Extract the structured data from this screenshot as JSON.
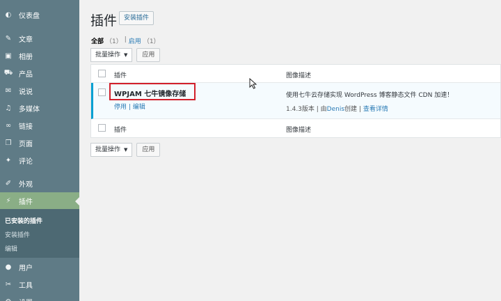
{
  "sidebar": {
    "items": [
      {
        "label": "仪表盘",
        "icon": "dashboard-icon",
        "glyph": "◐"
      },
      {
        "label": "文章",
        "icon": "pin-icon",
        "glyph": "✎"
      },
      {
        "label": "相册",
        "icon": "gallery-icon",
        "glyph": "▣"
      },
      {
        "label": "产品",
        "icon": "cart-icon",
        "glyph": "⛟"
      },
      {
        "label": "说说",
        "icon": "chat-icon",
        "glyph": "✉"
      },
      {
        "label": "多媒体",
        "icon": "media-icon",
        "glyph": "♫"
      },
      {
        "label": "链接",
        "icon": "link-icon",
        "glyph": "∞"
      },
      {
        "label": "页面",
        "icon": "page-icon",
        "glyph": "❐"
      },
      {
        "label": "评论",
        "icon": "comment-icon",
        "glyph": "✦"
      },
      {
        "label": "外观",
        "icon": "brush-icon",
        "glyph": "✐"
      },
      {
        "label": "插件",
        "icon": "plugin-icon",
        "glyph": "⚡"
      },
      {
        "label": "用户",
        "icon": "user-icon",
        "glyph": "●"
      },
      {
        "label": "工具",
        "icon": "wrench-icon",
        "glyph": "✂"
      },
      {
        "label": "设置",
        "icon": "settings-icon",
        "glyph": "⚙"
      }
    ],
    "submenu": [
      "已安装的插件",
      "安装插件",
      "编辑"
    ]
  },
  "header": {
    "title": "插件",
    "add_button": "安装插件"
  },
  "filters": {
    "all_label": "全部",
    "all_count": "（1）",
    "separator": "|",
    "active_label": "启用",
    "active_count": "（1）"
  },
  "bulk": {
    "select_label": "批量操作",
    "apply_label": "应用"
  },
  "table": {
    "col_name": "插件",
    "col_desc": "图像描述",
    "plugin": {
      "name": "WPJAM 七牛镜像存储",
      "actions": "停用 | 编辑",
      "description": "使用七牛云存储实现 WordPress 博客静态文件 CDN 加速！",
      "version": "1.4.3版本 | 由",
      "author": "Denis",
      "created": "创建 |",
      "details": "查看详情"
    }
  },
  "colors": {
    "sidebar_bg": "#5f7b86",
    "active_menu": "#8aae86",
    "highlight": "#d21f2a",
    "active_row_border": "#00a0d2",
    "link": "#2a7bb5"
  }
}
